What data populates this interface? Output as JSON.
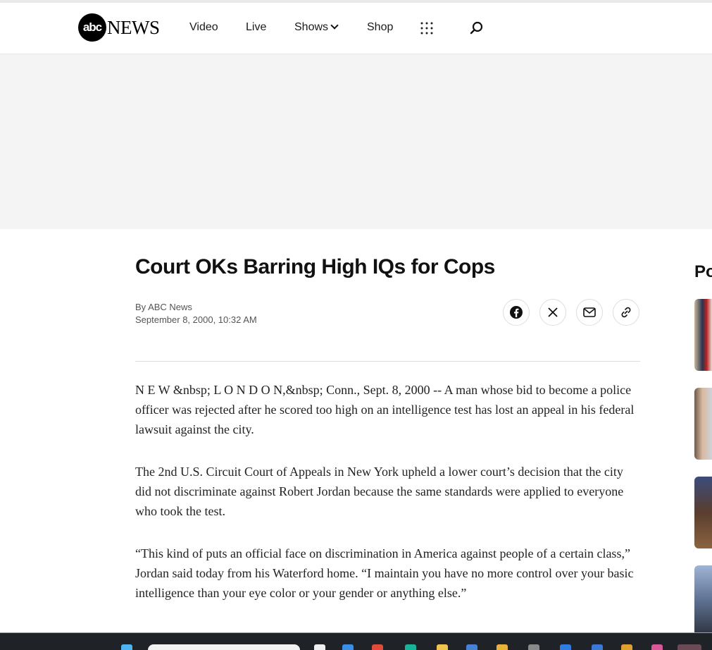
{
  "header": {
    "logo_badge": "abc",
    "logo_text": "NEWS",
    "nav": [
      {
        "label": "Video"
      },
      {
        "label": "Live"
      },
      {
        "label": "Shows"
      },
      {
        "label": "Shop"
      }
    ]
  },
  "article": {
    "title": "Court OKs Barring High IQs for Cops",
    "byline": "By ABC News",
    "date": "September 8, 2000, 10:32 AM",
    "paragraphs": [
      "N E W &nbsp; L O N D O N,&nbsp; Conn., Sept. 8, 2000 -- A man whose bid to become a police officer was rejected after he scored too high on an intelligence test has lost an appeal in his federal lawsuit against the city.",
      "The 2nd U.S. Circuit Court of Appeals in New York upheld a lower court’s decision that the city did not discriminate against Robert Jordan because the same standards were applied to everyone who took the test.",
      "“This kind of puts an official face on discrimination in America against people of a certain class,” Jordan said today from his Waterford home. “I maintain you have no more control over your basic intelligence than your eye color or your gender or anything else.”"
    ]
  },
  "share_icons": [
    "facebook-icon",
    "x-icon",
    "mail-icon",
    "link-icon"
  ],
  "sidebar": {
    "heading": "Po"
  },
  "colors": {
    "ad_background": "#f4f4f4",
    "taskbar": "#1f2328"
  }
}
